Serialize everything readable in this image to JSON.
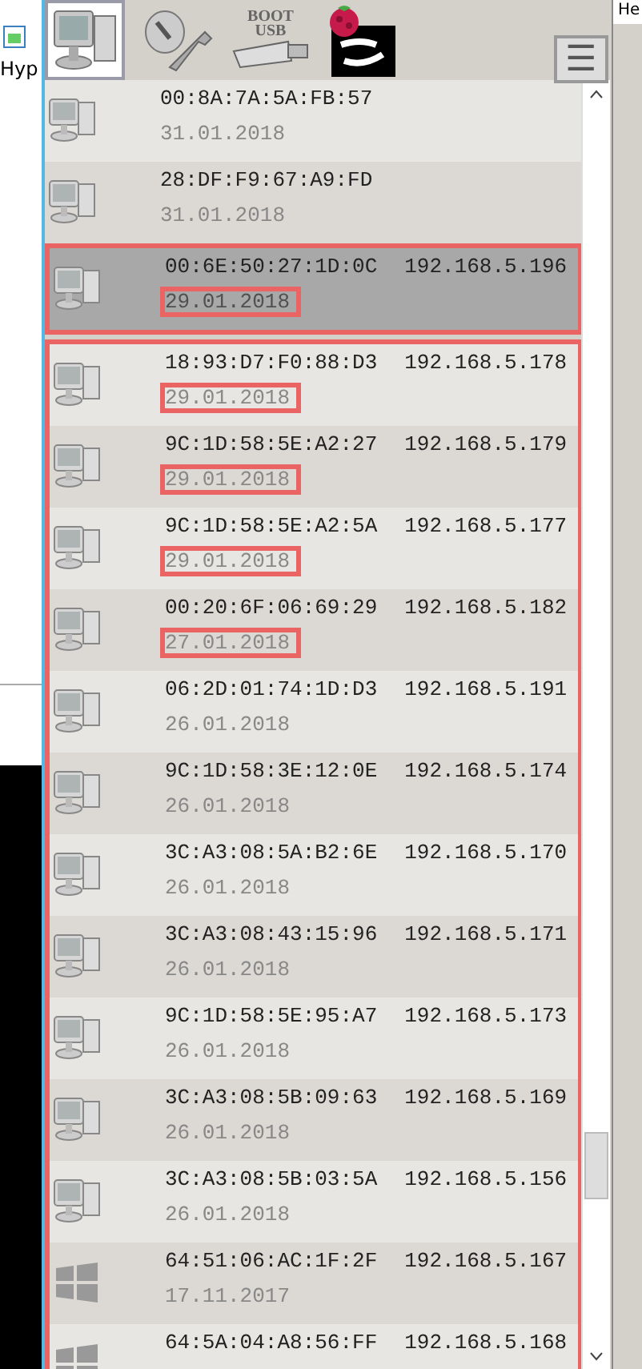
{
  "background_window": {
    "label": "Hyp"
  },
  "right_window": {
    "label": "He"
  },
  "toolbar": {
    "tools": [
      {
        "kind": "computer",
        "selected": true
      },
      {
        "kind": "wrench",
        "selected": false
      },
      {
        "kind": "usb",
        "selected": false,
        "label": "BOOT\nUSB"
      },
      {
        "kind": "raspberry",
        "selected": false
      }
    ],
    "menu_button": "☰"
  },
  "device_groups": [
    {
      "outlined": false,
      "rows": [
        {
          "kind": "pc",
          "mac": "00:8A:7A:5A:FB:57",
          "date": "31.01.2018",
          "date_outlined": false,
          "selected": false
        },
        {
          "kind": "pc",
          "mac": "28:DF:F9:67:A9:FD",
          "date": "31.01.2018",
          "date_outlined": false,
          "selected": false
        }
      ]
    },
    {
      "outlined": true,
      "rows": [
        {
          "kind": "pc",
          "mac": "00:6E:50:27:1D:0C",
          "ip": "192.168.5.196",
          "date": "29.01.2018",
          "date_outlined": true,
          "selected": true
        }
      ]
    },
    {
      "outlined": true,
      "rows": [
        {
          "kind": "pc",
          "mac": "18:93:D7:F0:88:D3",
          "ip": "192.168.5.178",
          "date": "29.01.2018",
          "date_outlined": true,
          "selected": false
        },
        {
          "kind": "pc",
          "mac": "9C:1D:58:5E:A2:27",
          "ip": "192.168.5.179",
          "date": "29.01.2018",
          "date_outlined": true,
          "selected": false
        },
        {
          "kind": "pc",
          "mac": "9C:1D:58:5E:A2:5A",
          "ip": "192.168.5.177",
          "date": "29.01.2018",
          "date_outlined": true,
          "selected": false
        },
        {
          "kind": "pc",
          "mac": "00:20:6F:06:69:29",
          "ip": "192.168.5.182",
          "date": "27.01.2018",
          "date_outlined": true,
          "selected": false
        },
        {
          "kind": "pc",
          "mac": "06:2D:01:74:1D:D3",
          "ip": "192.168.5.191",
          "date": "26.01.2018",
          "date_outlined": false,
          "selected": false
        },
        {
          "kind": "pc",
          "mac": "9C:1D:58:3E:12:0E",
          "ip": "192.168.5.174",
          "date": "26.01.2018",
          "date_outlined": false,
          "selected": false
        },
        {
          "kind": "pc",
          "mac": "3C:A3:08:5A:B2:6E",
          "ip": "192.168.5.170",
          "date": "26.01.2018",
          "date_outlined": false,
          "selected": false
        },
        {
          "kind": "pc",
          "mac": "3C:A3:08:43:15:96",
          "ip": "192.168.5.171",
          "date": "26.01.2018",
          "date_outlined": false,
          "selected": false
        },
        {
          "kind": "pc",
          "mac": "9C:1D:58:5E:95:A7",
          "ip": "192.168.5.173",
          "date": "26.01.2018",
          "date_outlined": false,
          "selected": false
        },
        {
          "kind": "pc",
          "mac": "3C:A3:08:5B:09:63",
          "ip": "192.168.5.169",
          "date": "26.01.2018",
          "date_outlined": false,
          "selected": false
        },
        {
          "kind": "pc",
          "mac": "3C:A3:08:5B:03:5A",
          "ip": "192.168.5.156",
          "date": "26.01.2018",
          "date_outlined": false,
          "selected": false
        },
        {
          "kind": "windows",
          "mac": "64:51:06:AC:1F:2F",
          "ip": "192.168.5.167",
          "date": "17.11.2017",
          "date_outlined": false,
          "selected": false
        },
        {
          "kind": "windows",
          "mac": "64:5A:04:A8:56:FF",
          "ip": "192.168.5.168",
          "selected": false
        }
      ]
    }
  ]
}
